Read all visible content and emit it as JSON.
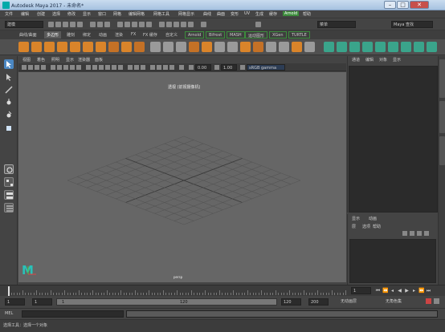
{
  "titlebar": {
    "title": "Autodesk Maya 2017 - 未命名*",
    "min": "–",
    "max": "□",
    "close": "✕"
  },
  "menu": {
    "items": [
      "文件",
      "编辑",
      "创建",
      "选择",
      "修改",
      "显示",
      "窗口",
      "网格",
      "编辑网格",
      "网格工具",
      "网格显示",
      "曲线",
      "曲面",
      "变形",
      "UV",
      "生成",
      "缓存",
      "Arnold",
      "帮助"
    ],
    "highlighted_index": 17
  },
  "statusline": {
    "mode_dropdown": "建模",
    "search_dropdown": "菜单",
    "right_field": "Maya 查找"
  },
  "shelf_tabs": {
    "items": [
      "曲线/曲面",
      "多边形",
      "雕刻",
      "绑定",
      "动画",
      "渲染",
      "FX",
      "FX 缓存",
      "自定义",
      "Arnold",
      "Bifrost",
      "MASH",
      "运动图形",
      "XGen",
      "TURTLE"
    ],
    "active_index": 1,
    "boxed": [
      9,
      10,
      11,
      12,
      13,
      14
    ]
  },
  "viewport_menu": {
    "items": [
      "视图",
      "着色",
      "照明",
      "显示",
      "渲染器",
      "面板"
    ]
  },
  "viewport_toolbar": {
    "value_a": "0.00",
    "value_b": "1.00",
    "colorspace": "sRGB gamma"
  },
  "viewport": {
    "view_label": "透视 (前视摄像机)",
    "camera_label": "persp"
  },
  "channel_box": {
    "tabs": [
      "通道",
      "编辑",
      "对象",
      "显示"
    ]
  },
  "layer_editor": {
    "tabs": [
      "显示",
      "动画"
    ],
    "menu": [
      "层",
      "选项",
      "帮助"
    ]
  },
  "time_slider": {
    "current_frame": "1",
    "ticks": [
      "5",
      "10",
      "15",
      "20",
      "25",
      "30",
      "35",
      "40",
      "45",
      "50",
      "55",
      "60",
      "65",
      "70",
      "75",
      "80",
      "85",
      "90",
      "95",
      "100",
      "105",
      "110",
      "115",
      "120"
    ]
  },
  "range_slider": {
    "start": "1",
    "start_inner": "1",
    "range_left": "1",
    "range_right": "120",
    "end_inner": "120",
    "end": "200",
    "anim_layer": "无动画层",
    "char_set": "无角色集"
  },
  "command_line": {
    "label": "MEL"
  },
  "help_line": {
    "text": "选择工具：选择一个对象"
  },
  "icons": {
    "select": "arrow-icon",
    "lasso": "lasso-icon",
    "paint": "paint-select-icon",
    "move": "move-icon",
    "rotate": "rotate-icon",
    "scale": "scale-icon"
  },
  "colors": {
    "accent_green": "#3c8c3c",
    "shelf_orange": "#d9842a",
    "maya_teal": "#29c1b8",
    "viewport_bg": "#666666"
  }
}
